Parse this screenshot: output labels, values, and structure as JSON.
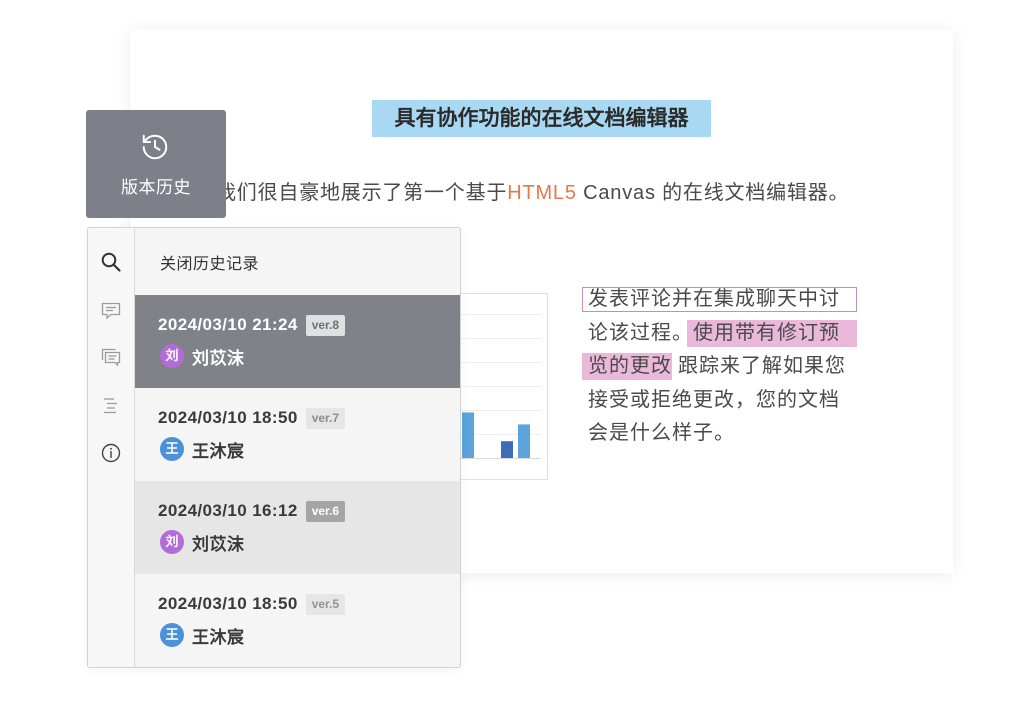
{
  "colors": {
    "title_highlight": "#a9d8f2",
    "link": "#e8774f",
    "revision_highlight": "#eab9da",
    "comment_border": "#c88cbb",
    "history_button": "#7d8088"
  },
  "history_button": {
    "icon": "history-icon",
    "label": "版本历史"
  },
  "document": {
    "title": "具有协作功能的在线文档编辑器",
    "intro_before": "我们很自豪地展示了第一个基于",
    "intro_link": "HTML5",
    "intro_after": " Canvas 的在线文档编辑器。",
    "comment": {
      "line1": "发表评论并在集成聊天中讨",
      "line2": "论该过程。",
      "line2_highlight": "使用带有修订预",
      "line3_highlight": "览的更改",
      "line3": "跟踪来了解如果您",
      "line4": "接受或拒绝更改，您的文档",
      "line5": "会是什么样子。"
    }
  },
  "chart_data": {
    "type": "bar",
    "ylim": [
      0,
      6
    ],
    "grid": true,
    "values": [
      1.9,
      0.7,
      1.4
    ],
    "colors": [
      "#5ba5dc",
      "#3d6db7",
      "#5ba5dc"
    ]
  },
  "history_panel": {
    "rail_icons": [
      "search-icon",
      "comment-icon",
      "chat-icon",
      "outline-icon",
      "info-icon"
    ],
    "close_label": "关闭历史记录",
    "versions": [
      {
        "datetime": "2024/03/10 21:24",
        "version": "ver.8",
        "avatar": "刘",
        "author": "刘苡沫",
        "avatar_color": "#b36bd8",
        "selected": true,
        "row_bg": "#7f8289",
        "text_color": "#ffffff",
        "badge_bg": "#dfe0e1",
        "badge_color": "#707070"
      },
      {
        "datetime": "2024/03/10 18:50",
        "version": "ver.7",
        "avatar": "王",
        "author": "王沐宸",
        "avatar_color": "#4b92db",
        "selected": false,
        "row_bg": "#f5f5f5",
        "text_color": "#3a3a3a",
        "badge_bg": "#e6e6e6",
        "badge_color": "#8c8c8c"
      },
      {
        "datetime": "2024/03/10 16:12",
        "version": "ver.6",
        "avatar": "刘",
        "author": "刘苡沫",
        "avatar_color": "#b36bd8",
        "selected": false,
        "row_bg": "#e6e6e6",
        "text_color": "#3a3a3a",
        "badge_bg": "#a5a5a5",
        "badge_color": "#ffffff"
      },
      {
        "datetime": "2024/03/10 18:50",
        "version": "ver.5",
        "avatar": "王",
        "author": "王沐宸",
        "avatar_color": "#4b92db",
        "selected": false,
        "row_bg": "#f5f5f5",
        "text_color": "#3a3a3a",
        "badge_bg": "#e6e6e6",
        "badge_color": "#939393"
      }
    ]
  }
}
